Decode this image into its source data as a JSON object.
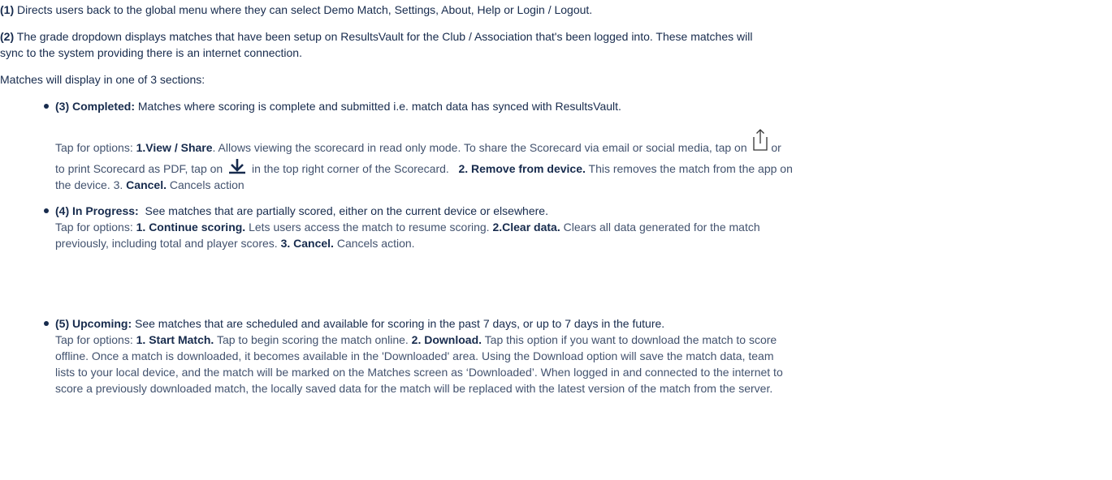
{
  "p1": {
    "tag": "(1)",
    "text": " Directs users back to the global menu where they can select Demo Match, Settings, About, Help or Login / Logout."
  },
  "p2": {
    "tag": "(2)",
    "line1": " The grade dropdown displays matches that have been setup on ResultsVault for the Club / Association that's been logged into. These matches will",
    "line2": "sync to the system providing there is an internet connection."
  },
  "p3": {
    "text": "Matches will display in one of 3 sections:"
  },
  "completed": {
    "heading": "(3) Completed:",
    "text": " Matches where scoring is complete and submitted i.e. match data has synced with ResultsVault.",
    "opt_prefix": "Tap for options: ",
    "opt1_label": "1.View / Share",
    "opt1_text": ". Allows viewing the scorecard in read only mode. To share the Scorecard via email or social media, tap on",
    "opt1_or": " or",
    "print_pre": "to print Scorecard as PDF, tap on",
    "print_post": " in the top right corner of the Scorecard.   ",
    "opt2_label": "2. Remove from device.",
    "opt2_text": " This removes the match from the app on",
    "line3_pre": "the device. 3. ",
    "opt3_label": "Cancel.",
    "opt3_text": " Cancels action"
  },
  "in_progress": {
    "heading": "(4) In Progress:",
    "text": "  See matches that are partially scored, either on the current device or elsewhere.",
    "opt_prefix": "Tap for options: ",
    "opt1_label": "1. Continue scoring.",
    "opt1_text": " Lets users access the match to resume scoring. ",
    "opt2_label": "2.Clear data.",
    "opt2_text": " Clears all data generated for the match",
    "line3_pre": "previously, including total and player scores. ",
    "opt3_label": "3. Cancel.",
    "opt3_text": " Cancels action."
  },
  "upcoming": {
    "heading": "(5) Upcoming:",
    "text": " See matches that are scheduled and available for scoring in the past 7 days, or up to 7 days in the future.",
    "opt_prefix": "Tap for options: ",
    "opt1_label": "1. Start Match.",
    "opt1_text": " Tap to begin scoring the match online. ",
    "opt2_label": "2. Download.",
    "opt2_text": " Tap this option if you want to download the match to score",
    "line3": "offline. Once a match is downloaded, it becomes available in the 'Downloaded' area. Using the Download option will save the match data, team",
    "line4": "lists to your local device, and the match will be marked on the Matches screen as ‘Downloaded’. When logged in and connected to the internet to",
    "line5": "score a previously downloaded match, the locally saved data for the match will be replaced with the latest version of the match from the server."
  },
  "icons": {
    "share": "share-icon",
    "download": "download-icon",
    "bullet": "bullet-icon"
  }
}
